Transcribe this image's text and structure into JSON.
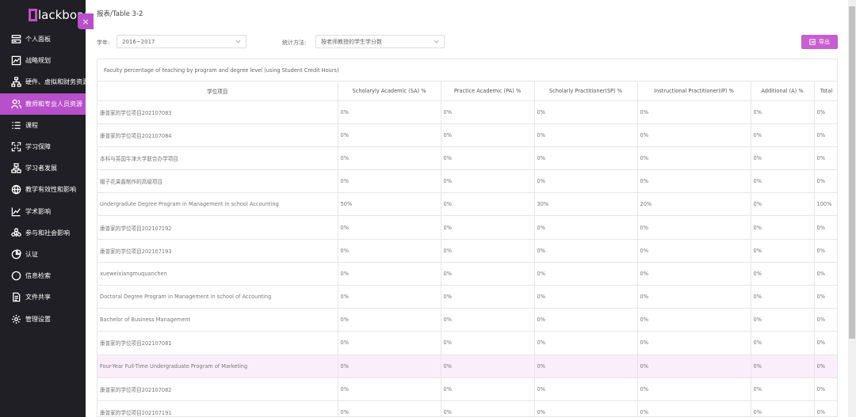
{
  "brand": {
    "logo_text": "lackboard"
  },
  "sidebar": {
    "items": [
      {
        "label": "个人面板",
        "icon": "dashboard-icon",
        "active": false
      },
      {
        "label": "战略规划",
        "icon": "chart-icon",
        "active": false
      },
      {
        "label": "硬件、虚拟和财务资源",
        "icon": "org-icon",
        "active": false
      },
      {
        "label": "教师和专业人员资源",
        "icon": "people-icon",
        "active": true
      },
      {
        "label": "课程",
        "icon": "list-icon",
        "active": false
      },
      {
        "label": "学习保障",
        "icon": "expand-icon",
        "active": false
      },
      {
        "label": "学习者发展",
        "icon": "tree-icon",
        "active": false
      },
      {
        "label": "教学有效性和影响",
        "icon": "globe-icon",
        "active": false
      },
      {
        "label": "学术影响",
        "icon": "trend-icon",
        "active": false
      },
      {
        "label": "参与和社会影响",
        "icon": "network-icon",
        "active": false
      },
      {
        "label": "认证",
        "icon": "pie-icon",
        "active": false
      },
      {
        "label": "信息检索",
        "icon": "chat-icon",
        "active": false
      },
      {
        "label": "文件共享",
        "icon": "file-icon",
        "active": false
      },
      {
        "label": "管理设置",
        "icon": "gear-icon",
        "active": false
      }
    ],
    "collapse_label": "×"
  },
  "page": {
    "title": "报表/Table 3-2",
    "filters": {
      "year_label": "学年:",
      "year_value": "2016~2017",
      "method_label": "统计方法:",
      "method_value": "按老师教授的学生学分数"
    },
    "export_label": "导出"
  },
  "table": {
    "caption": "Faculty percentage of teaching by program and degree level (using Student Credit Hours)",
    "columns": [
      "学位项目",
      "Scholaryly Academic (SA) %",
      "Practice Academic (PA) %",
      "Scholarly Practitioner(SP) %",
      "Instructional Practitioner(IP) %",
      "Additional (A) %",
      "Total"
    ],
    "rows": [
      [
        "康普家的学位项目202107083",
        "0%",
        "0%",
        "0%",
        "0%",
        "0%",
        "0%"
      ],
      [
        "康普家的学位项目202107084",
        "0%",
        "0%",
        "0%",
        "0%",
        "0%",
        "0%"
      ],
      [
        "本科与英国牛津大学联合办学项目",
        "0%",
        "0%",
        "0%",
        "0%",
        "0%",
        "0%"
      ],
      [
        "帽子花果酱制作的高级项目",
        "0%",
        "0%",
        "0%",
        "0%",
        "0%",
        "0%"
      ],
      [
        "Undergradute Degree Program in Management in school Accounting",
        "50%",
        "0%",
        "30%",
        "20%",
        "0%",
        "100%"
      ],
      [
        "康普家的学位项目202107192",
        "0%",
        "0%",
        "0%",
        "0%",
        "0%",
        "0%"
      ],
      [
        "康普家的学位项目202107193",
        "0%",
        "0%",
        "0%",
        "0%",
        "0%",
        "0%"
      ],
      [
        "xueweixiangmuquanchen",
        "0%",
        "0%",
        "0%",
        "0%",
        "0%",
        "0%"
      ],
      [
        "Doctoral Degree Program in Management in school of Accounting",
        "0%",
        "0%",
        "0%",
        "0%",
        "0%",
        "0%"
      ],
      [
        "Bachelor of Business Management",
        "0%",
        "0%",
        "0%",
        "0%",
        "0%",
        "0%"
      ],
      [
        "康普家的学位项目202107081",
        "0%",
        "0%",
        "0%",
        "0%",
        "0%",
        "0%"
      ],
      [
        "Four-Year Full-Time Undergraduate Program of Marketing",
        "0%",
        "0%",
        "0%",
        "0%",
        "0%",
        "0%"
      ],
      [
        "康普家的学位项目202107082",
        "0%",
        "0%",
        "0%",
        "0%",
        "0%",
        "0%"
      ],
      [
        "康普家的学位项目202107191",
        "0%",
        "0%",
        "0%",
        "0%",
        "0%",
        "0%"
      ]
    ],
    "highlighted_row": 11
  },
  "colors": {
    "accent": "#b84fcb",
    "sidebar_bg": "#1f1f25",
    "highlight_row": "#fbeefb"
  }
}
